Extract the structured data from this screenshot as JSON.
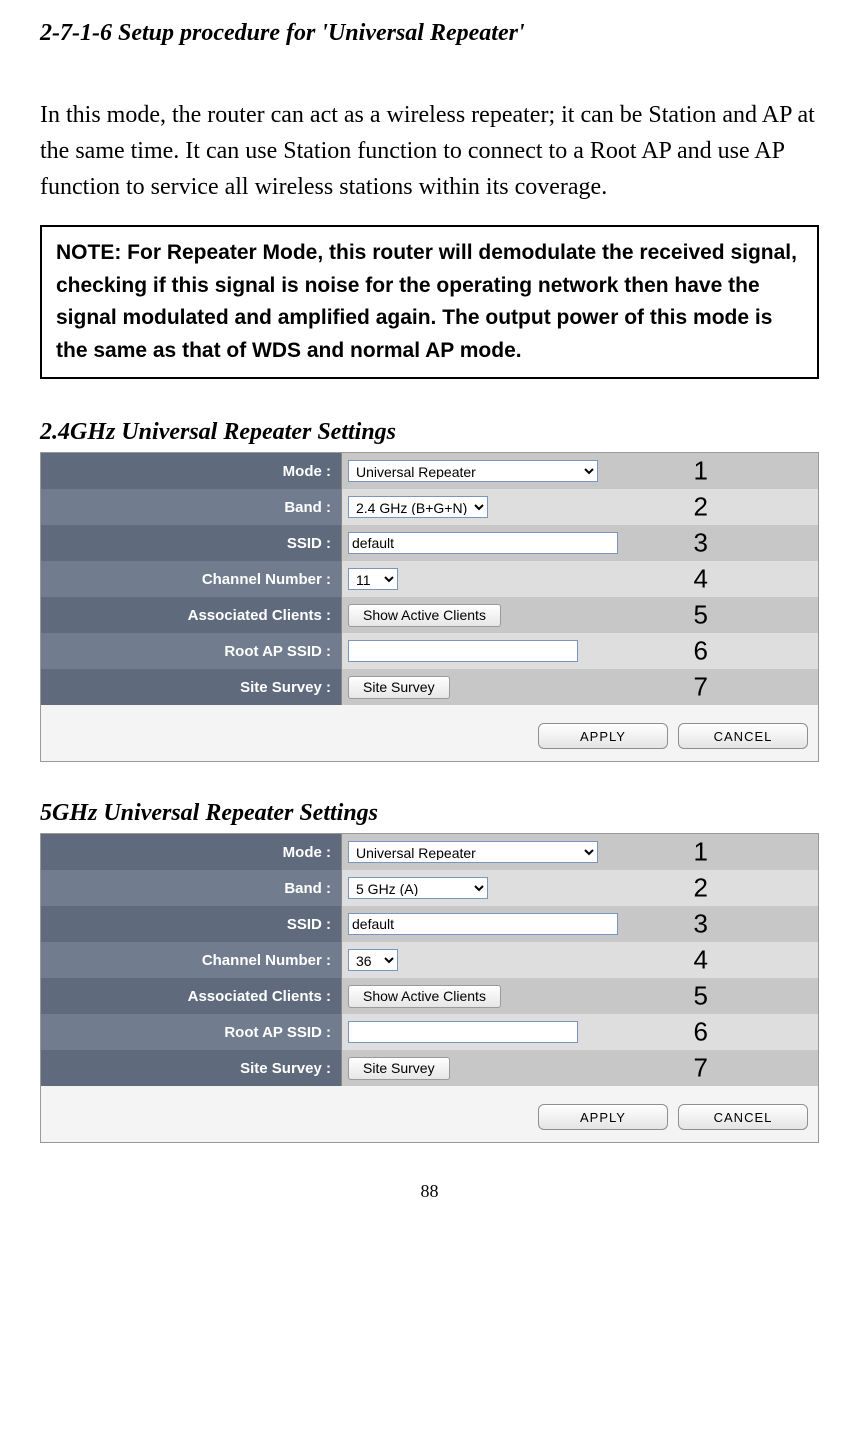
{
  "heading": "2-7-1-6 Setup procedure for 'Universal Repeater'",
  "intro": "In this mode, the router can act as a wireless repeater; it can be Station and AP at the same time. It can use Station function to connect to a Root AP and use AP function to service all wireless stations within its coverage.",
  "note": "NOTE: For Repeater Mode, this router will demodulate the received signal, checking if this signal is noise for the operating network then have the signal modulated and amplified again. The output power of this mode is the same as that of WDS and normal AP mode.",
  "panels": {
    "p24": {
      "title": "2.4GHz Universal Repeater Settings",
      "rows": {
        "mode": {
          "label": "Mode :",
          "value": "Universal Repeater",
          "annot": "1"
        },
        "band": {
          "label": "Band :",
          "value": "2.4 GHz (B+G+N)",
          "annot": "2"
        },
        "ssid": {
          "label": "SSID :",
          "value": "default",
          "annot": "3"
        },
        "chan": {
          "label": "Channel Number :",
          "value": "11",
          "annot": "4"
        },
        "assoc": {
          "label": "Associated Clients :",
          "btn": "Show Active Clients",
          "annot": "5"
        },
        "root": {
          "label": "Root AP SSID :",
          "value": "",
          "annot": "6"
        },
        "survey": {
          "label": "Site Survey :",
          "btn": "Site Survey",
          "annot": "7"
        }
      }
    },
    "p5": {
      "title": "5GHz Universal Repeater Settings",
      "rows": {
        "mode": {
          "label": "Mode :",
          "value": "Universal Repeater",
          "annot": "1"
        },
        "band": {
          "label": "Band :",
          "value": "5 GHz (A)",
          "annot": "2"
        },
        "ssid": {
          "label": "SSID :",
          "value": "default",
          "annot": "3"
        },
        "chan": {
          "label": "Channel Number :",
          "value": "36",
          "annot": "4"
        },
        "assoc": {
          "label": "Associated Clients :",
          "btn": "Show Active Clients",
          "annot": "5"
        },
        "root": {
          "label": "Root AP SSID :",
          "value": "",
          "annot": "6"
        },
        "survey": {
          "label": "Site Survey :",
          "btn": "Site Survey",
          "annot": "7"
        }
      }
    }
  },
  "buttons": {
    "apply": "APPLY",
    "cancel": "CANCEL"
  },
  "page_number": "88"
}
